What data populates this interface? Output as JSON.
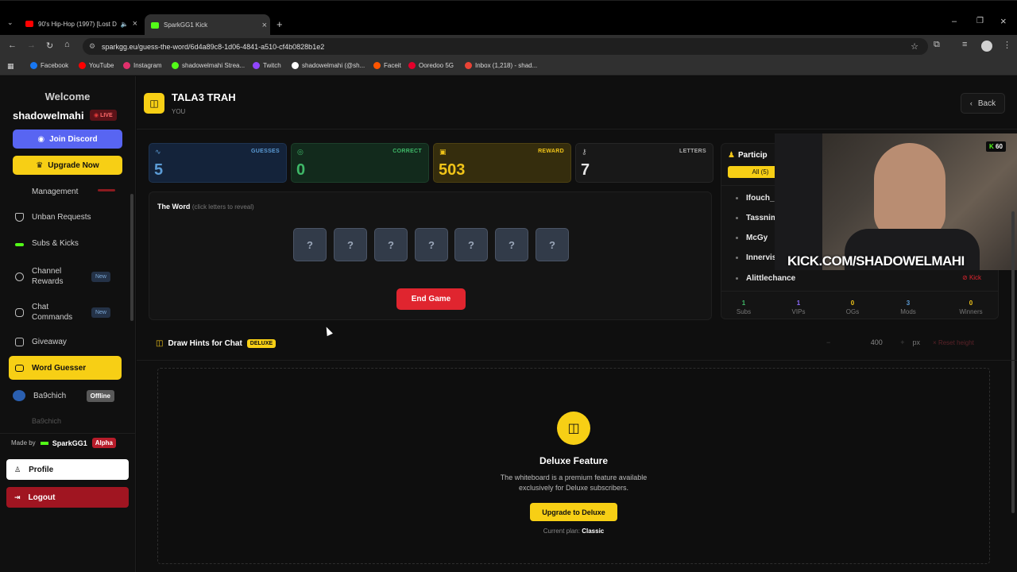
{
  "browser": {
    "tabs": [
      {
        "title": "90's Hip-Hop (1997) [Lost D"
      },
      {
        "title": "SparkGG1 Kick"
      }
    ],
    "url": "sparkgg.eu/guess-the-word/6d4a89c8-1d06-4841-a510-cf4b0828b1e2",
    "bookmarks": [
      {
        "label": "Facebook",
        "color": "#1877f2"
      },
      {
        "label": "YouTube",
        "color": "#ff0000"
      },
      {
        "label": "Instagram",
        "color": "#e1306c"
      },
      {
        "label": "shadowelmahi Strea...",
        "color": "#53fc18"
      },
      {
        "label": "Twitch",
        "color": "#9146ff"
      },
      {
        "label": "shadowelmahi (@sh...",
        "color": "#ffffff"
      },
      {
        "label": "Faceit",
        "color": "#ff5500"
      },
      {
        "label": "Ooredoo 5G",
        "color": "#e4002b"
      },
      {
        "label": "Inbox (1,218) - shad...",
        "color": "#ea4335"
      }
    ]
  },
  "sidebar": {
    "welcome": "Welcome",
    "username": "shadowelmahi",
    "live": "LIVE",
    "join_discord": "Join Discord",
    "upgrade_now": "Upgrade Now",
    "items": [
      {
        "label": "Management",
        "icon": "gear-icon"
      },
      {
        "label": "Unban Requests",
        "icon": "shield-icon"
      },
      {
        "label": "Subs & Kicks",
        "icon": "kick-icon"
      },
      {
        "label": "Channel Rewards",
        "icon": "gift-icon",
        "badge": "New"
      },
      {
        "label": "Chat Commands",
        "icon": "command-icon",
        "badge": "New"
      },
      {
        "label": "Giveaway",
        "icon": "gift-icon"
      },
      {
        "label": "Word Guesser",
        "icon": "gamepad-icon"
      },
      {
        "label": "Ba9chich",
        "icon": "avatar-icon",
        "badge": "Offline"
      },
      {
        "label": "Ba9chich"
      }
    ],
    "made_by": "Made by",
    "author": "SparkGG1",
    "alpha": "Alpha",
    "profile": "Profile",
    "logout": "Logout"
  },
  "header": {
    "title": "TALA3 TRAH",
    "subtitle": "YOU",
    "back": "Back"
  },
  "stats": [
    {
      "label": "GUESSES",
      "value": "5",
      "color": "#5b9bd5"
    },
    {
      "label": "CORRECT",
      "value": "0",
      "color": "#3fb868"
    },
    {
      "label": "REWARD",
      "value": "503",
      "color": "#f0c419"
    },
    {
      "label": "LETTERS",
      "value": "7",
      "color": "#e6e6e6"
    }
  ],
  "word": {
    "title": "The Word",
    "hint": "(click letters to reveal)",
    "letters": [
      "?",
      "?",
      "?",
      "?",
      "?",
      "?",
      "?"
    ],
    "end_game": "End Game"
  },
  "participants": {
    "title": "Particip",
    "filter": "All (5)",
    "names": [
      "Ifouch_",
      "Tassnim",
      "McGy",
      "Innervis",
      "Alittlechance"
    ],
    "kick_label": "Kick",
    "summary": [
      {
        "n": "1",
        "l": "Subs",
        "c": "#3fb868"
      },
      {
        "n": "1",
        "l": "VIPs",
        "c": "#8e6cff"
      },
      {
        "n": "0",
        "l": "OGs",
        "c": "#f0c419"
      },
      {
        "n": "3",
        "l": "Mods",
        "c": "#5b9bd5"
      },
      {
        "n": "0",
        "l": "Winners",
        "c": "#f0c419"
      }
    ]
  },
  "hints": {
    "title": "Draw Hints for Chat",
    "tag": "DELUXE",
    "height": "400",
    "unit": "px",
    "reset": "Reset height"
  },
  "deluxe": {
    "title": "Deluxe Feature",
    "desc1": "The whiteboard is a premium feature available",
    "desc2": "exclusively for Deluxe subscribers.",
    "button": "Upgrade to Deluxe",
    "plan_label": "Current plan:",
    "plan": "Classic"
  },
  "webcam": {
    "overlay_text": "KICK.COM/SHADOWELMAHI",
    "viewers": "60"
  }
}
